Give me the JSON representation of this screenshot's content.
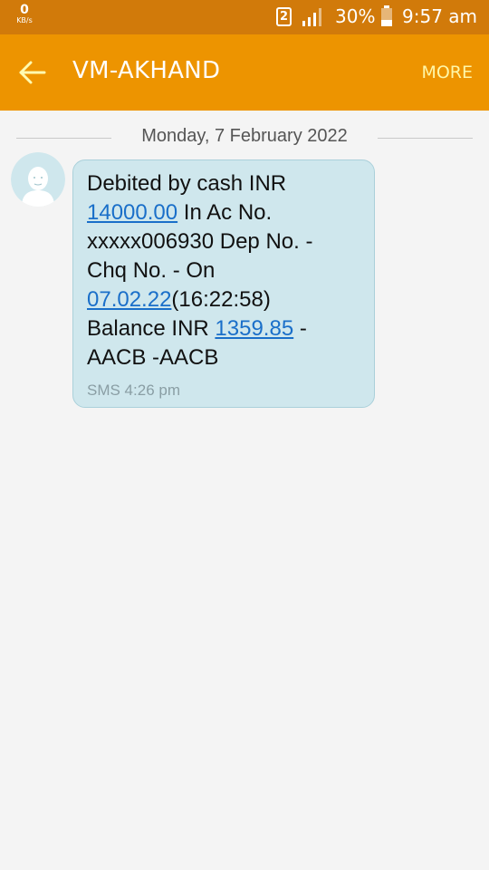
{
  "status_bar": {
    "speed_value": "0",
    "speed_unit": "KB/s",
    "sim_slot": "2",
    "battery_percent": "30%",
    "time": "9:57 am"
  },
  "app_bar": {
    "title": "VM-AKHAND",
    "more_label": "MORE"
  },
  "conversation": {
    "date_divider": "Monday, 7 February 2022",
    "message": {
      "line1": "Debited by cash INR",
      "amount_link": "14000.00",
      "line2_rest": " In Ac No.",
      "line3": "xxxxx006930 Dep No. -",
      "line4": "Chq No. - On",
      "date_link": "07.02.22",
      "line5_rest": "(16:22:58)",
      "line6_prefix": "Balance INR ",
      "balance_link": "1359.85",
      "line6_rest": " -",
      "line7": "AACB -AACB",
      "meta": "SMS 4:26 pm"
    }
  },
  "colors": {
    "status_bar": "#d17a0a",
    "app_bar": "#ed9400",
    "more_text": "#fff7a8",
    "bubble": "#cfe7ed",
    "link": "#1a6fc9"
  }
}
